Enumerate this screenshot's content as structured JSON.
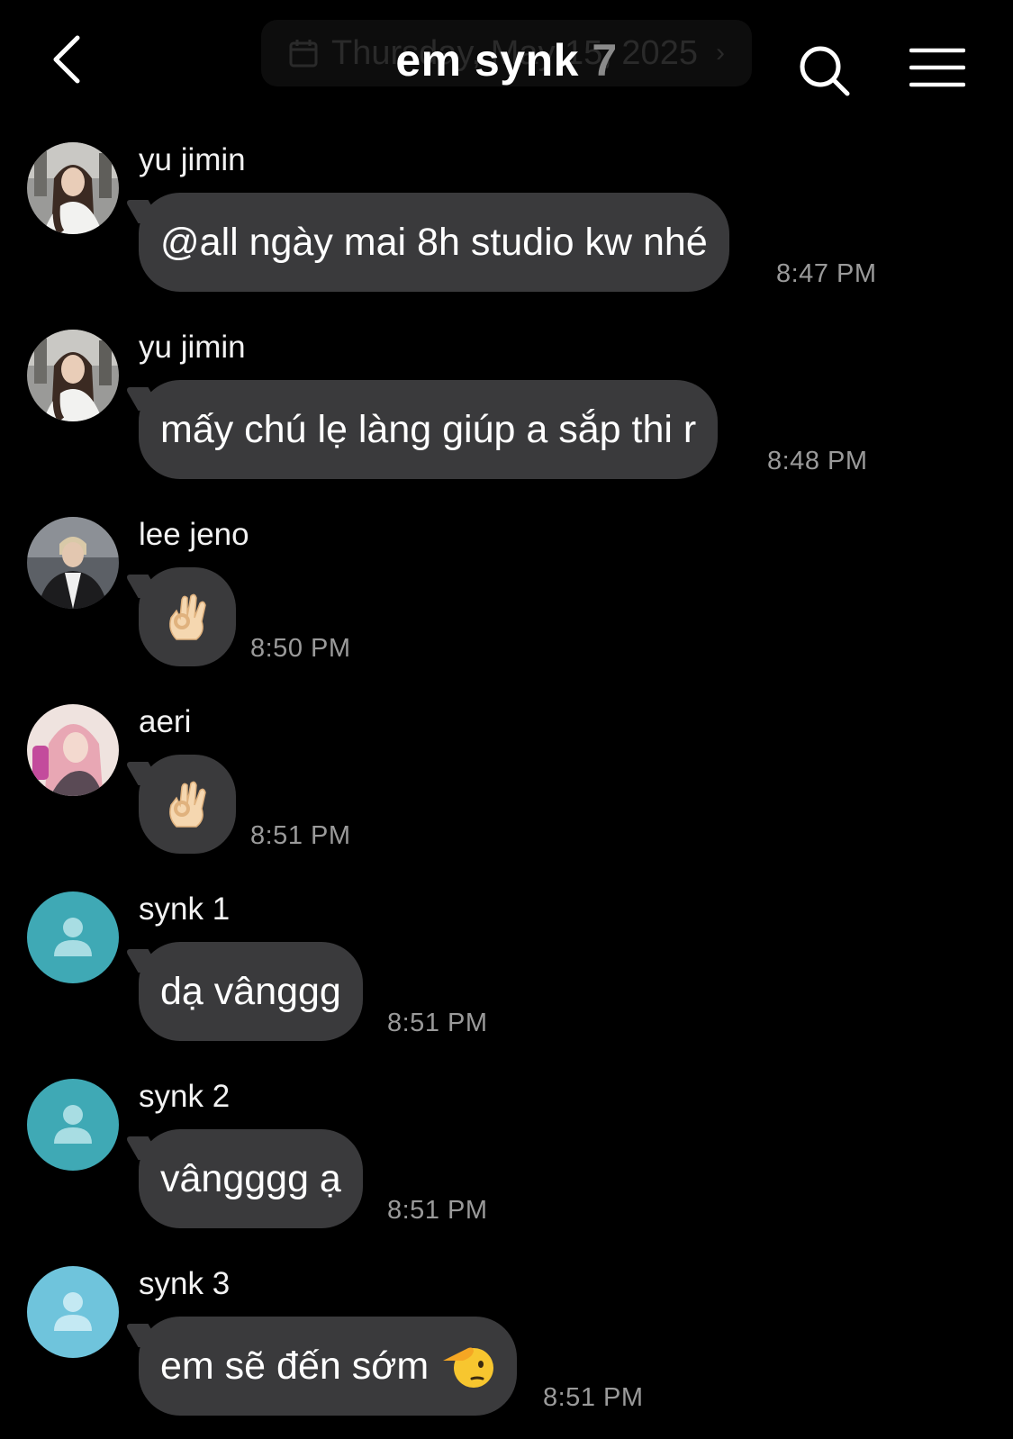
{
  "header": {
    "title": "em synk",
    "member_count": "7",
    "date_pill": "Thursday, May 15, 2025",
    "back_icon": "chevron-left-icon",
    "search_icon": "search-icon",
    "menu_icon": "hamburger-menu-icon"
  },
  "messages": [
    {
      "sender": "yu jimin",
      "text": "@all ngày mai 8h studio kw nhé",
      "time": "8:47 PM",
      "avatar": "photo"
    },
    {
      "sender": "yu jimin",
      "text": "mấy chú lẹ làng giúp a sắp thi r",
      "time": "8:48 PM",
      "avatar": "photo"
    },
    {
      "sender": "lee jeno",
      "text": "👌",
      "time": "8:50 PM",
      "avatar": "photo",
      "emoji": "ok-hand"
    },
    {
      "sender": "aeri",
      "text": "👌",
      "time": "8:51 PM",
      "avatar": "photo",
      "emoji": "ok-hand"
    },
    {
      "sender": "synk 1",
      "text": "dạ vânggg",
      "time": "8:51 PM",
      "avatar": "default"
    },
    {
      "sender": "synk 2",
      "text": "vângggg ạ",
      "time": "8:51 PM",
      "avatar": "default"
    },
    {
      "sender": "synk 3",
      "text": "em sẽ đến sớm",
      "time": "8:51 PM",
      "avatar": "default",
      "trailing_emoji": "saluting-face"
    }
  ],
  "colors": {
    "background": "#000000",
    "bubble": "#3a3a3c",
    "time": "#9a9a9a",
    "default_avatar_teal": "#3fa9b5",
    "default_avatar_light": "#6fc4dc"
  }
}
